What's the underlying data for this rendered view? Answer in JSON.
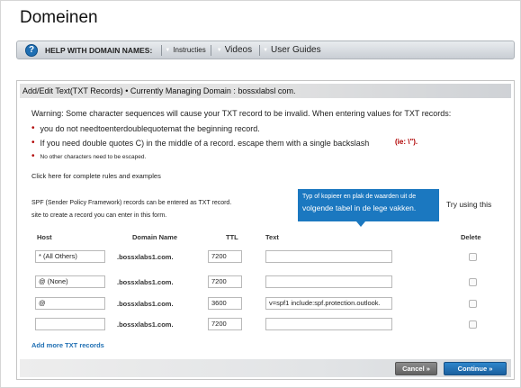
{
  "page": {
    "title": "Domeinen"
  },
  "help_bar": {
    "icon": "help-icon",
    "icon_glyph": "?",
    "title": "HELP WITH DOMAIN NAMES:",
    "links": [
      "Instructies",
      "Videos",
      "User Guides"
    ]
  },
  "panel": {
    "header": "Add/Edit Text(TXT Records) • Currently Managing Domain : bossxlabsl com.",
    "warning": "Warning: Some character sequences will cause your TXT record to be invalid. When entering values for TXT records:",
    "bullets": [
      "you do not needtoenterdoublequotemat the beginning record.",
      "If you need double quotes C) in the middle of a record. escape them with a single backslash",
      "No other characters need to be escaped."
    ],
    "ie_note": "(ie: \\\").",
    "rules_link": "Click here for complete rules and examples",
    "spf_line1": "SPF (Sender Policy Framework) records can be entered as TXT record.",
    "spf_try": "Try using this",
    "spf_line2": "site to create a record you can enter in this form."
  },
  "tooltip": {
    "line1": "Typ of kopieer en plak de waarden uit de",
    "line2": "volgende tabel in de lege vakken."
  },
  "table": {
    "headers": {
      "host": "Host",
      "domain": "Domain Name",
      "ttl": "TTL",
      "text": "Text",
      "delete": "Delete"
    },
    "rows": [
      {
        "host": "* (All Others)",
        "domain": ".bossxlabs1.com.",
        "ttl": "7200",
        "text": ""
      },
      {
        "host": "@ (None)",
        "domain": ".bossxlabs1.com.",
        "ttl": "7200",
        "text": ""
      },
      {
        "host": "@",
        "domain": ".bossxlabs1.com.",
        "ttl": "3600",
        "text": "v=spf1 include:spf.protection.outlook."
      },
      {
        "host": "",
        "domain": ".bossxlabs1.com.",
        "ttl": "7200",
        "text": ""
      }
    ]
  },
  "add_more": "Add more TXT records",
  "buttons": {
    "cancel": "Cancel »",
    "continue": "Continue »"
  },
  "colors": {
    "accent": "#1b78c0",
    "warning_red": "#b00000",
    "link_blue": "#1f6fb3"
  }
}
